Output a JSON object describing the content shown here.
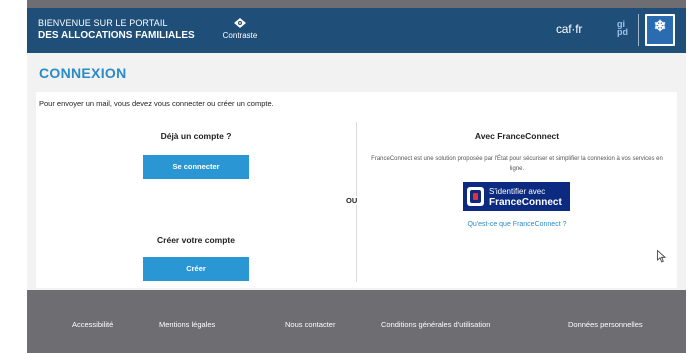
{
  "header": {
    "brand_line1": "BIENVENUE SUR LE PORTAIL",
    "brand_line2": "DES ALLOCATIONS FAMILIALES",
    "contrast_label": "Contraste",
    "logo_caffr": "caf·fr",
    "logo_gip_line1": "gi",
    "logo_gip_line2": "pd"
  },
  "page": {
    "title": "CONNEXION",
    "intro": "Pour envoyer un mail, vous devez vous connecter ou créer un compte."
  },
  "left": {
    "heading_account": "Déjà un compte ?",
    "login_button": "Se connecter",
    "heading_create": "Créer votre compte",
    "create_button": "Créer"
  },
  "separator_label": "OU",
  "right": {
    "heading": "Avec FranceConnect",
    "description": "FranceConnect est une solution proposée par l'État pour sécuriser et simplifier la connexion à vos services en ligne.",
    "fc_button_line1": "S'identifier avec",
    "fc_button_line2": "FranceConnect",
    "fc_link": "Qu'est-ce que FranceConnect ?"
  },
  "footer": {
    "links": [
      "Accessibilité",
      "Mentions légales",
      "Nous contacter",
      "Conditions générales d'utilisation",
      "Données personnelles"
    ]
  },
  "colors": {
    "header_bg": "#1f4e79",
    "accent": "#2a97d4",
    "link": "#2a8bc7",
    "fc_blue": "#0b2a80",
    "footer_bg": "#6d6d72"
  },
  "icons": {
    "contrast": "eye-icon",
    "secu": "snowflake-logo-icon",
    "fc": "franceconnect-logo-icon",
    "cursor": "mouse-pointer-icon"
  }
}
